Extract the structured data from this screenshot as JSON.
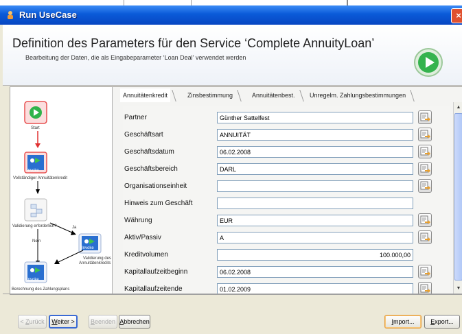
{
  "window": {
    "title": "Run UseCase"
  },
  "header": {
    "title": "Definition des Parameters für den Service ‘Complete AnnuityLoan’",
    "subtitle": "Bearbeitung der Daten, die als Eingabeparameter ‘Loan Deal’ verwendet werden"
  },
  "flow": {
    "start": "Start",
    "vollstaendig": "Vollständiger Annuitätenkredit",
    "invoke": "Invoke",
    "validierung_q": "Validierung erforderlich?",
    "ja": "Ja",
    "nein": "Nein",
    "validierung_des": "Validierung des",
    "annuitaetenkredits": "Annuitätenkredits",
    "berechnung": "Berechnung des Zahlungsplans"
  },
  "tabs": [
    {
      "label": "Annuitätenkredit"
    },
    {
      "label": "Zinsbestimmung"
    },
    {
      "label": "Annuitätenbest."
    },
    {
      "label": "Unregelm. Zahlungsbestimmungen"
    }
  ],
  "form": {
    "rows": [
      {
        "label": "Partner",
        "value": "Günther Sattelfest"
      },
      {
        "label": "Geschäftsart",
        "value": "ANNUITÄT"
      },
      {
        "label": "Geschäftsdatum",
        "value": "06.02.2008"
      },
      {
        "label": "Geschäftsbereich",
        "value": "DARL"
      },
      {
        "label": "Organisationseinheit",
        "value": ""
      },
      {
        "label": "Hinweis zum Geschäft",
        "value": ""
      },
      {
        "label": "Währung",
        "value": "EUR"
      },
      {
        "label": "Aktiv/Passiv",
        "value": "A"
      },
      {
        "label": "Kreditvolumen",
        "value": "100.000,00"
      },
      {
        "label": "Kapitallaufzeitbeginn",
        "value": "06.02.2008"
      },
      {
        "label": "Kapitallaufzeitende",
        "value": "01.02.2009"
      }
    ]
  },
  "buttons": {
    "back_prefix": "< ",
    "back_mnemonic": "Z",
    "back_rest": "urück",
    "next_mnemonic": "W",
    "next_rest": "eiter >",
    "finish_mnemonic": "B",
    "finish_rest": "eenden",
    "cancel_mnemonic": "A",
    "cancel_rest": "bbrechen",
    "import_mnemonic": "I",
    "import_rest": "mport...",
    "export_mnemonic": "E",
    "export_rest": "xport..."
  },
  "colors": {
    "titlebar": "#0a5ad8",
    "start_node": "#e85050",
    "invoke_node": "#2a6fd0",
    "accent_green": "#2fb34a"
  }
}
